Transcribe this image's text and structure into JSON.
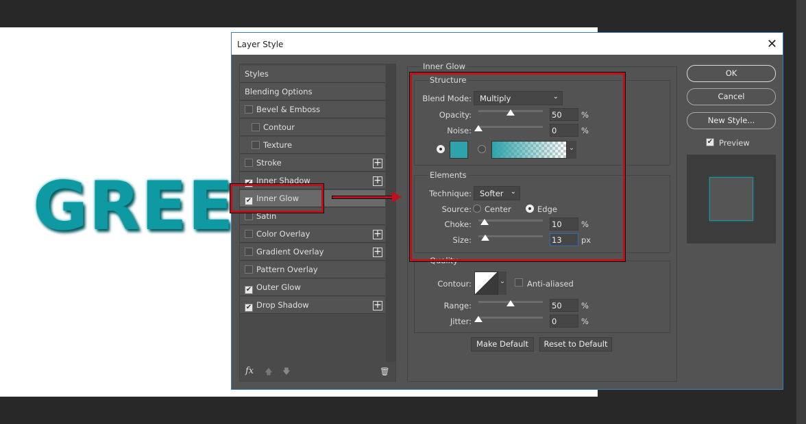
{
  "canvas": {
    "text": "GREEN",
    "text_color": "#0f9aa3"
  },
  "dialog": {
    "title": "Layer Style",
    "close_icon": "close-icon"
  },
  "styles_list": [
    {
      "label": "Styles",
      "checkbox": false
    },
    {
      "label": "Blending Options",
      "checkbox": false
    },
    {
      "label": "Bevel & Emboss",
      "checkbox": true,
      "checked": false
    },
    {
      "label": "Contour",
      "checkbox": true,
      "checked": false,
      "indent": true
    },
    {
      "label": "Texture",
      "checkbox": true,
      "checked": false,
      "indent": true
    },
    {
      "label": "Stroke",
      "checkbox": true,
      "checked": false,
      "plus": true
    },
    {
      "label": "Inner Shadow",
      "checkbox": true,
      "checked": true,
      "plus": true
    },
    {
      "label": "Inner Glow",
      "checkbox": true,
      "checked": true,
      "selected": true
    },
    {
      "label": "Satin",
      "checkbox": true,
      "checked": false
    },
    {
      "label": "Color Overlay",
      "checkbox": true,
      "checked": false,
      "plus": true
    },
    {
      "label": "Gradient Overlay",
      "checkbox": true,
      "checked": false,
      "plus": true
    },
    {
      "label": "Pattern Overlay",
      "checkbox": true,
      "checked": false
    },
    {
      "label": "Outer Glow",
      "checkbox": true,
      "checked": true
    },
    {
      "label": "Drop Shadow",
      "checkbox": true,
      "checked": true,
      "plus": true
    }
  ],
  "list_footer": {
    "fx": "fx"
  },
  "panel": {
    "title": "Inner Glow",
    "structure": {
      "title": "Structure",
      "blend_mode_label": "Blend Mode:",
      "blend_mode": "Multiply",
      "opacity_label": "Opacity:",
      "opacity": "50",
      "opacity_unit": "%",
      "noise_label": "Noise:",
      "noise": "0",
      "noise_unit": "%",
      "color": "#2fa3ab",
      "color_mode": "solid"
    },
    "elements": {
      "title": "Elements",
      "technique_label": "Technique:",
      "technique": "Softer",
      "source_label": "Source:",
      "source_center": "Center",
      "source_edge": "Edge",
      "source": "Edge",
      "choke_label": "Choke:",
      "choke": "10",
      "choke_unit": "%",
      "size_label": "Size:",
      "size": "13",
      "size_unit": "px"
    },
    "quality": {
      "title": "Quality",
      "contour_label": "Contour:",
      "anti_aliased": "Anti-aliased",
      "anti_aliased_checked": false,
      "range_label": "Range:",
      "range": "50",
      "range_unit": "%",
      "jitter_label": "Jitter:",
      "jitter": "0",
      "jitter_unit": "%"
    },
    "make_default": "Make Default",
    "reset_default": "Reset to Default"
  },
  "buttons": {
    "ok": "OK",
    "cancel": "Cancel",
    "new_style": "New Style...",
    "preview": "Preview",
    "preview_checked": true
  },
  "annotation_color": "#c0101a"
}
